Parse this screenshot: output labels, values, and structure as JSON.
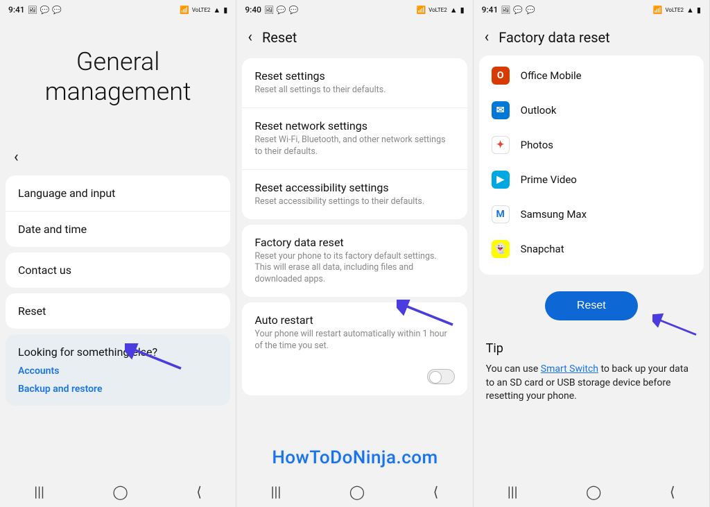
{
  "status": {
    "time1": "9:41",
    "time2": "9:40",
    "time3": "9:41",
    "volte": "VoLTE2",
    "signal": "📶",
    "battery": "🔋"
  },
  "screen1": {
    "title": "General management",
    "items": [
      {
        "label": "Language and input"
      },
      {
        "label": "Date and time"
      },
      {
        "label": "Contact us"
      },
      {
        "label": "Reset"
      }
    ],
    "search": {
      "heading": "Looking for something else?",
      "link1": "Accounts",
      "link2": "Backup and restore"
    }
  },
  "screen2": {
    "title": "Reset",
    "items": [
      {
        "title": "Reset settings",
        "sub": "Reset all settings to their defaults."
      },
      {
        "title": "Reset network settings",
        "sub": "Reset Wi-Fi, Bluetooth, and other network settings to their defaults."
      },
      {
        "title": "Reset accessibility settings",
        "sub": "Reset accessibility settings to their defaults."
      },
      {
        "title": "Factory data reset",
        "sub": "Reset your phone to its factory default settings. This will erase all data, including files and downloaded apps."
      },
      {
        "title": "Auto restart",
        "sub": "Your phone will restart automatically within 1 hour of the time you set."
      }
    ]
  },
  "screen3": {
    "title": "Factory data reset",
    "apps": [
      {
        "label": "Office Mobile",
        "bg": "#d83b01",
        "glyph": "O"
      },
      {
        "label": "Outlook",
        "bg": "#0078d4",
        "glyph": "✉"
      },
      {
        "label": "Photos",
        "bg": "#ffffff",
        "glyph": "✦",
        "fg": "#ea4335",
        "border": "1px solid #ddd"
      },
      {
        "label": "Prime Video",
        "bg": "#00a8e1",
        "glyph": "▶"
      },
      {
        "label": "Samsung Max",
        "bg": "#ffffff",
        "glyph": "M",
        "fg": "#1a73e8",
        "border": "1px solid #ddd"
      },
      {
        "label": "Snapchat",
        "bg": "#fffc00",
        "glyph": "👻",
        "fg": "#000"
      }
    ],
    "button": "Reset",
    "tip_heading": "Tip",
    "tip_before": "You can use ",
    "tip_link": "Smart Switch",
    "tip_after": " to back up your data to an SD card or USB storage device before resetting your phone."
  },
  "watermark": "HowToDoNinja.com",
  "nav_icons": {
    "recents": "|||",
    "home": "◯",
    "back": "⟨"
  }
}
